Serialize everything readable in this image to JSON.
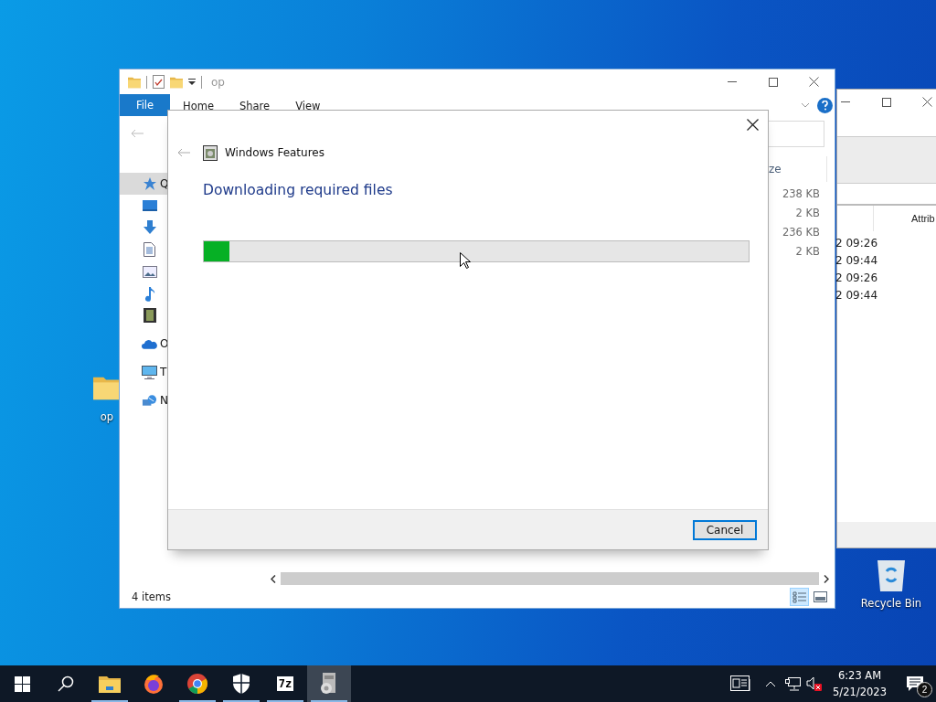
{
  "desktop_icons": [
    {
      "kind": "folder",
      "label": "op"
    },
    {
      "kind": "recycle-bin",
      "label": "Recycle Bin"
    }
  ],
  "back_window": {
    "column": "Attrib",
    "rows": [
      "2 09:26",
      "2 09:44",
      "2 09:26",
      "2 09:44"
    ]
  },
  "explorer": {
    "title": "op",
    "file_tab": "File",
    "ribbon_tabs": [
      "Home",
      "Share",
      "View"
    ],
    "sidebar": [
      {
        "kind": "quick-access",
        "label": "Q",
        "selected": true
      },
      {
        "kind": "desktop",
        "selected": false
      },
      {
        "kind": "downloads",
        "selected": false
      },
      {
        "kind": "documents",
        "selected": false
      },
      {
        "kind": "pictures",
        "selected": false
      },
      {
        "kind": "music",
        "selected": false
      },
      {
        "kind": "videos",
        "selected": false
      },
      {
        "kind": "onedrive",
        "label": "O",
        "selected": false
      },
      {
        "kind": "this-pc",
        "label": "T",
        "selected": false
      },
      {
        "kind": "network",
        "label": "N",
        "selected": false
      }
    ],
    "column_header": "ze",
    "sizes": [
      "238 KB",
      "2 KB",
      "236 KB",
      "2 KB"
    ],
    "status": "4 items",
    "views": [
      {
        "kind": "details",
        "selected": true
      },
      {
        "kind": "preview",
        "selected": false
      }
    ]
  },
  "dialog": {
    "title": "Windows Features",
    "heading": "Downloading required files",
    "progress": {
      "level": 0.047
    },
    "button": "Cancel"
  },
  "taskbar": {
    "apps": [
      {
        "kind": "file-explorer",
        "running": true,
        "selected": false
      },
      {
        "kind": "firefox",
        "running": false,
        "selected": false
      },
      {
        "kind": "chrome",
        "running": true,
        "selected": false
      },
      {
        "kind": "shield",
        "running": true,
        "selected": false
      },
      {
        "kind": "archiver",
        "running": true,
        "selected": false,
        "text": "7z"
      },
      {
        "kind": "features",
        "running": true,
        "selected": true
      }
    ],
    "time": "6:23 AM",
    "date": "5/21/2023",
    "notifications": "2"
  }
}
